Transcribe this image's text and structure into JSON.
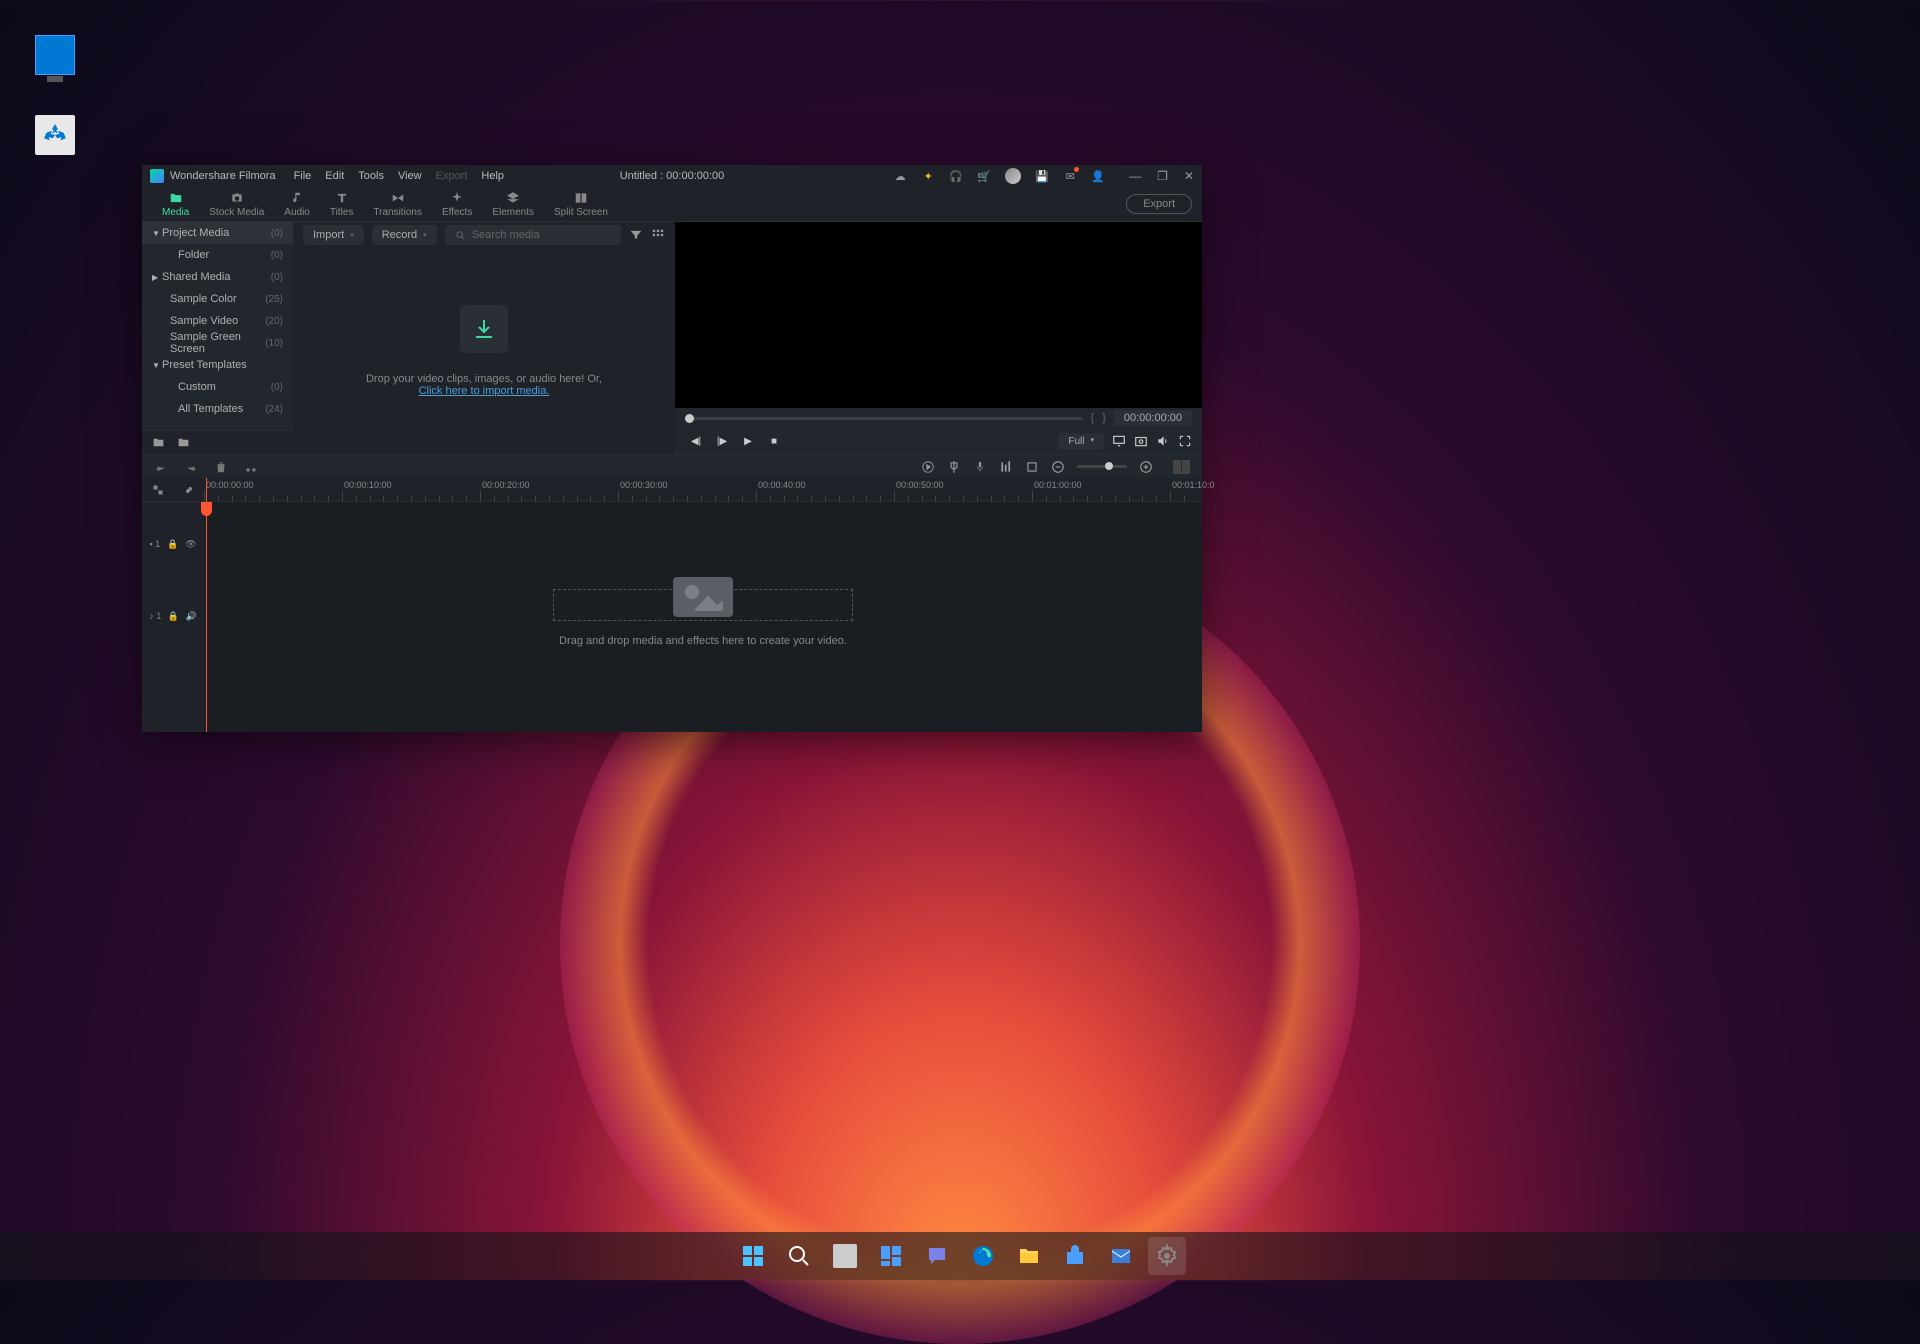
{
  "app": {
    "name": "Wondershare Filmora",
    "menu": [
      "File",
      "Edit",
      "Tools",
      "View",
      "Export",
      "Help"
    ],
    "disabled_menu": [
      "Export"
    ],
    "title": "Untitled : 00:00:00:00",
    "export_button": "Export"
  },
  "tabs": [
    {
      "label": "Media",
      "active": true
    },
    {
      "label": "Stock Media"
    },
    {
      "label": "Audio"
    },
    {
      "label": "Titles"
    },
    {
      "label": "Transitions"
    },
    {
      "label": "Effects"
    },
    {
      "label": "Elements"
    },
    {
      "label": "Split Screen"
    }
  ],
  "sidebar": {
    "items": [
      {
        "label": "Project Media",
        "count": "(0)",
        "arrow": "▼",
        "selected": true
      },
      {
        "label": "Folder",
        "count": "(0)",
        "indent": 2
      },
      {
        "label": "Shared Media",
        "count": "(0)",
        "arrow": "▶"
      },
      {
        "label": "Sample Color",
        "count": "(25)",
        "indent": 1
      },
      {
        "label": "Sample Video",
        "count": "(20)",
        "indent": 1
      },
      {
        "label": "Sample Green Screen",
        "count": "(10)",
        "indent": 1
      },
      {
        "label": "Preset Templates",
        "count": "",
        "arrow": "▼"
      },
      {
        "label": "Custom",
        "count": "(0)",
        "indent": 2
      },
      {
        "label": "All Templates",
        "count": "(24)",
        "indent": 2
      }
    ]
  },
  "media_toolbar": {
    "import": "Import",
    "record": "Record",
    "search_placeholder": "Search media"
  },
  "media_empty": {
    "text": "Drop your video clips, images, or audio here! Or,",
    "link": "Click here to import media."
  },
  "preview": {
    "timecode": "00:00:00:00",
    "quality": "Full"
  },
  "timeline": {
    "ruler": [
      "00:00:00:00",
      "00:00:10:00",
      "00:00:20:00",
      "00:00:30:00",
      "00:00:40:00",
      "00:00:50:00",
      "00:01:00:00",
      "00:01:10:0"
    ],
    "hint": "Drag and drop media and effects here to create your video.",
    "video_track": "1",
    "audio_track": "1"
  },
  "desktop": {
    "monitor": "This PC",
    "recycle": "Recycle Bin"
  }
}
